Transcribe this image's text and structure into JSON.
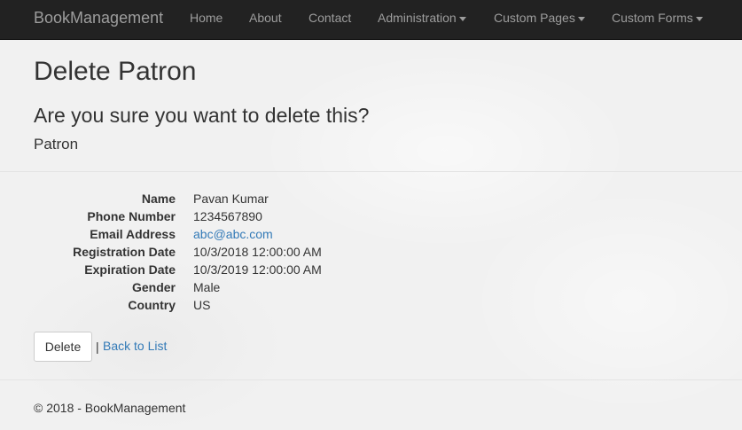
{
  "navbar": {
    "brand": "BookManagement",
    "items": [
      {
        "label": "Home",
        "dropdown": false
      },
      {
        "label": "About",
        "dropdown": false
      },
      {
        "label": "Contact",
        "dropdown": false
      },
      {
        "label": "Administration",
        "dropdown": true
      },
      {
        "label": "Custom Pages",
        "dropdown": true
      },
      {
        "label": "Custom Forms",
        "dropdown": true
      }
    ]
  },
  "page": {
    "title": "Delete Patron",
    "confirm": "Are you sure you want to delete this?",
    "entity": "Patron"
  },
  "details": [
    {
      "label": "Name",
      "value": "Pavan Kumar"
    },
    {
      "label": "Phone Number",
      "value": "1234567890"
    },
    {
      "label": "Email Address",
      "value": "abc@abc.com"
    },
    {
      "label": "Registration Date",
      "value": "10/3/2018 12:00:00 AM"
    },
    {
      "label": "Expiration Date",
      "value": "10/3/2019 12:00:00 AM"
    },
    {
      "label": "Gender",
      "value": "Male"
    },
    {
      "label": "Country",
      "value": "US"
    }
  ],
  "actions": {
    "delete_label": "Delete",
    "separator": "|",
    "back_label": "Back to List"
  },
  "footer": {
    "text": "© 2018 - BookManagement"
  },
  "colors": {
    "navbar_bg": "#222222",
    "nav_text": "#9d9d9d",
    "link": "#337ab7",
    "text": "#333333"
  }
}
